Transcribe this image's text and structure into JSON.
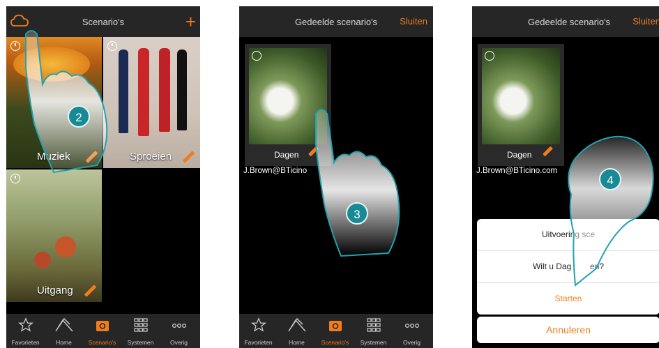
{
  "colors": {
    "accent": "#f07c1e",
    "bar": "#262626",
    "badge": "#188a96"
  },
  "screen1": {
    "title": "Scenario's",
    "plus": "+",
    "tiles": [
      {
        "label": "Muziek"
      },
      {
        "label": "Sproeien"
      },
      {
        "label": "Uitgang"
      }
    ],
    "step": "2"
  },
  "screen2": {
    "title": "Gedeelde scenario's",
    "close": "Sluiten",
    "card_label": "Dagen",
    "email": "J.Brown@BTicino",
    "step": "3"
  },
  "screen3": {
    "title": "Gedeelde scenario's",
    "close": "Sluiten",
    "card_label": "Dagen",
    "email": "J.Brown@BTicino.com",
    "step": "4",
    "sheet": {
      "title": "Uitvoering sce",
      "question": "Wilt u Dag",
      "question_end": "en?",
      "start": "Starten"
    },
    "cancel": "Annuleren"
  },
  "tabbar": [
    {
      "label": "Favorieten",
      "icon": "star-icon"
    },
    {
      "label": "Home",
      "icon": "house-icon"
    },
    {
      "label": "Scenario's",
      "icon": "scenario-icon",
      "active": true
    },
    {
      "label": "Systemen",
      "icon": "grid-icon"
    },
    {
      "label": "Overig",
      "icon": "more-icon"
    }
  ]
}
